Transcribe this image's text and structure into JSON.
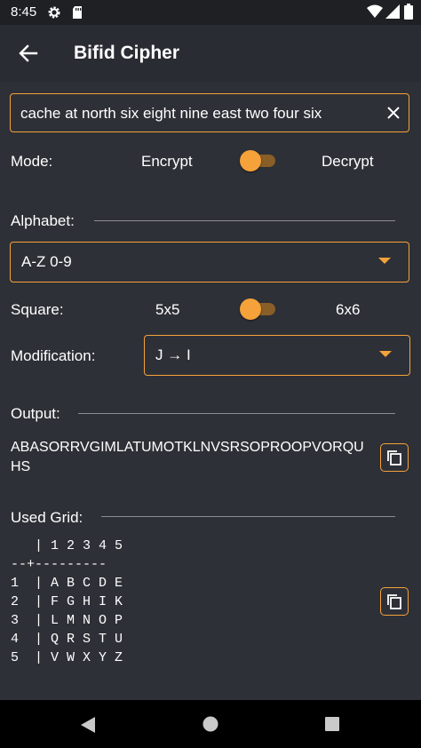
{
  "status_bar": {
    "time": "8:45"
  },
  "app_bar": {
    "title": "Bifid Cipher"
  },
  "input": {
    "value": "cache at north six eight nine east two four six"
  },
  "mode": {
    "label": "Mode:",
    "left": "Encrypt",
    "right": "Decrypt",
    "toggle_on": false
  },
  "alphabet": {
    "label": "Alphabet:",
    "selected": "A-Z 0-9"
  },
  "square": {
    "label": "Square:",
    "left": "5x5",
    "right": "6x6",
    "toggle_on": false
  },
  "modification": {
    "label": "Modification:",
    "selected": "J → I"
  },
  "output": {
    "label": "Output:",
    "value": "ABASORRVGIMLATUMOTKLNVSRSOPROOPVORQUHS"
  },
  "used_grid": {
    "label": "Used Grid:",
    "text": "   | 1 2 3 4 5\n--+---------\n1  | A B C D E\n2  | F G H I K\n3  | L M N O P\n4  | Q R S T U\n5  | V W X Y Z"
  },
  "colors": {
    "accent": "#f5a23a",
    "background": "#2e3037",
    "appbar": "#2a2c33"
  }
}
